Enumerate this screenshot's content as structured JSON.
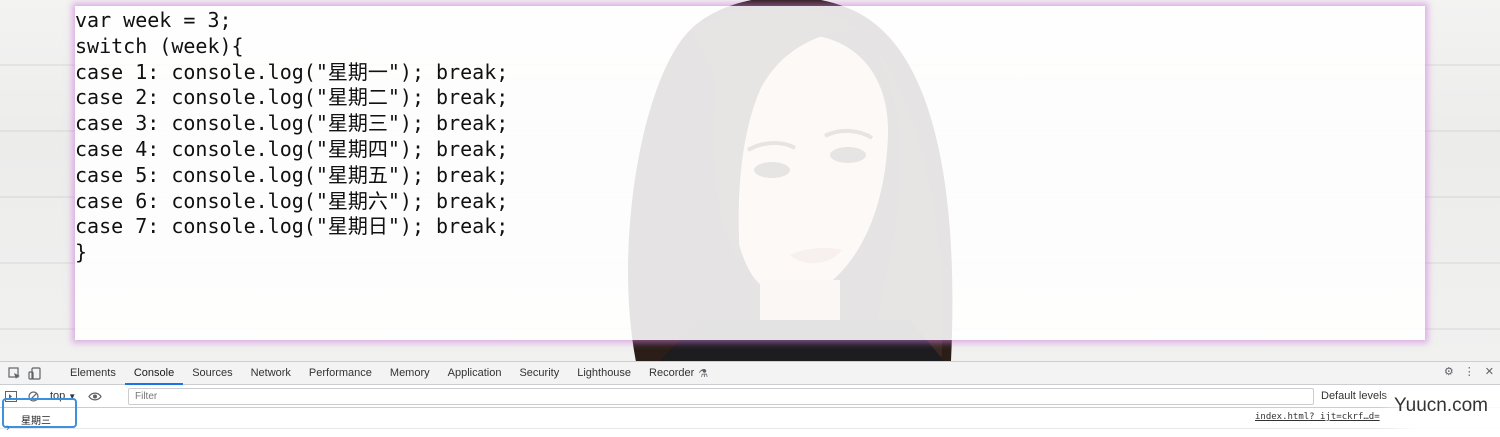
{
  "code": {
    "lines": [
      "var week = 3;",
      "switch (week){",
      "case 1: console.log(\"星期一\"); break;",
      "case 2: console.log(\"星期二\"); break;",
      "case 3: console.log(\"星期三\"); break;",
      "case 4: console.log(\"星期四\"); break;",
      "case 5: console.log(\"星期五\"); break;",
      "case 6: console.log(\"星期六\"); break;",
      "case 7: console.log(\"星期日\"); break;",
      "}"
    ]
  },
  "devtools": {
    "tabs": [
      "Elements",
      "Console",
      "Sources",
      "Network",
      "Performance",
      "Memory",
      "Application",
      "Security",
      "Lighthouse",
      "Recorder"
    ],
    "active_tab": "Console",
    "context": "top",
    "filter_placeholder": "Filter",
    "levels_label": "Default levels",
    "log": {
      "message": "星期三",
      "source": "index.html?_ijt=ckrf…d="
    },
    "accent_color": "#1a73e8"
  },
  "watermark": "Yuucn.com"
}
